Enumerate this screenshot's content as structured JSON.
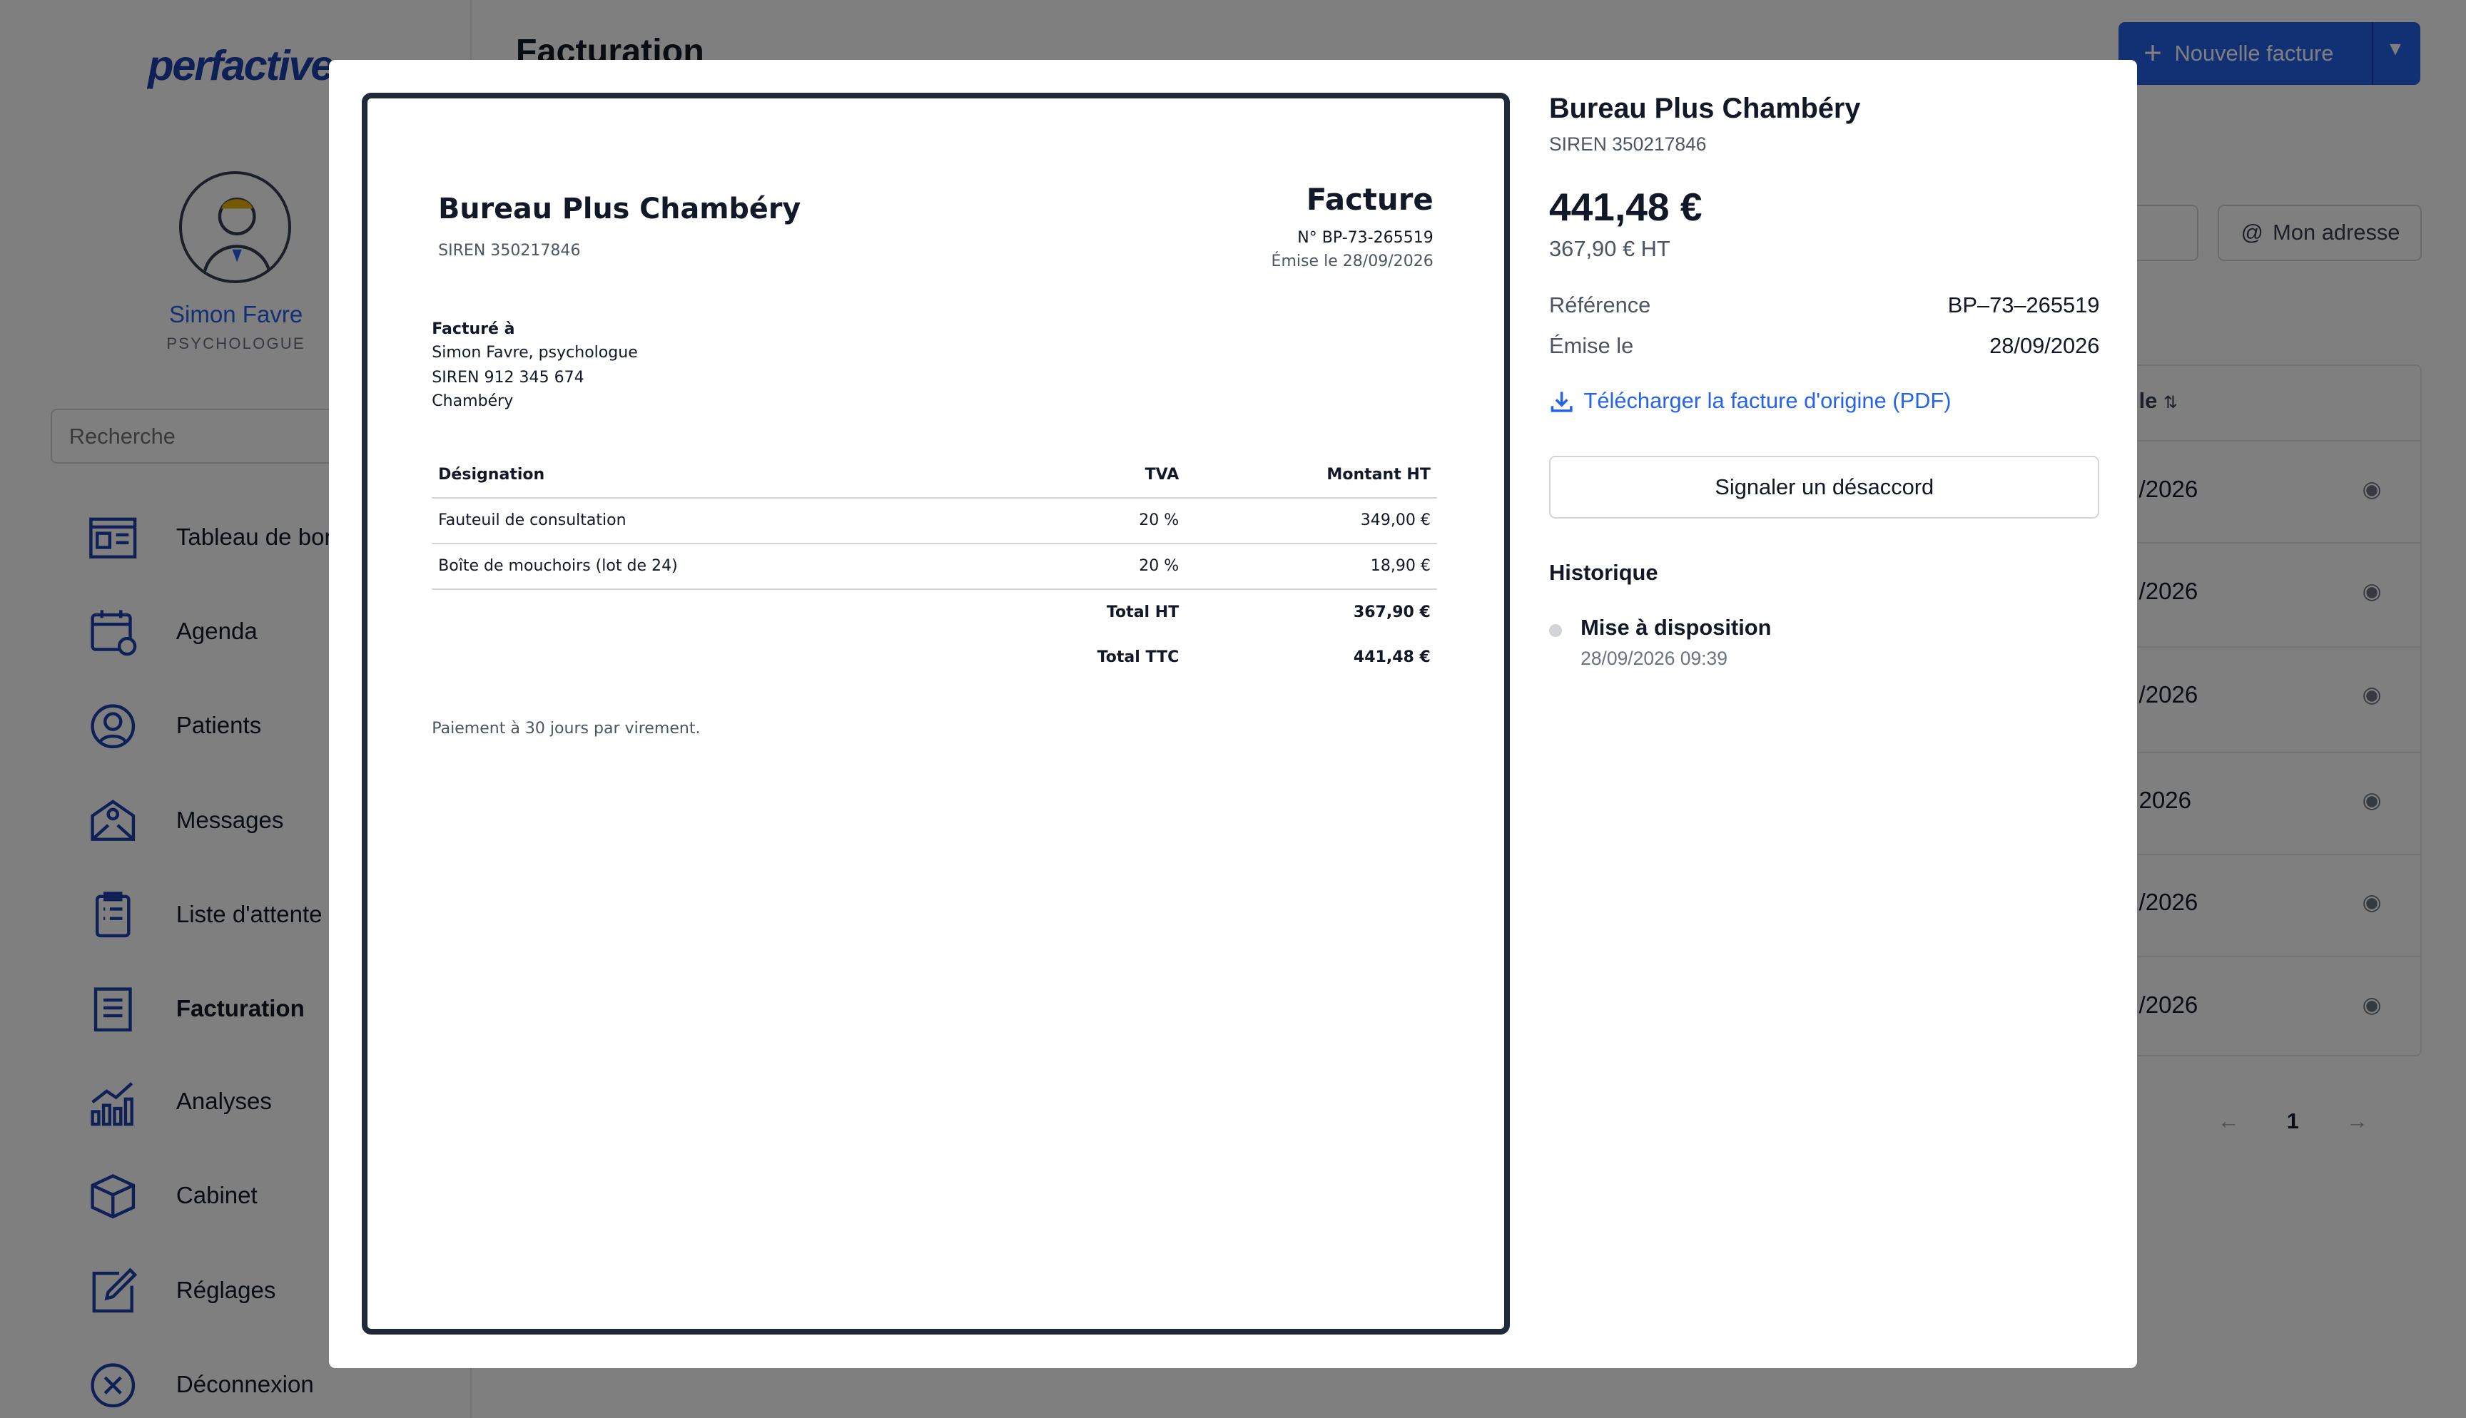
{
  "app": {
    "logo": "perfactive",
    "page_title": "Facturation"
  },
  "user": {
    "name": "Simon Favre",
    "role": "PSYCHOLOGUE"
  },
  "search": {
    "placeholder": "Recherche"
  },
  "nav": [
    {
      "label": "Tableau de bord",
      "icon": "dashboard-icon"
    },
    {
      "label": "Agenda",
      "icon": "calendar-icon"
    },
    {
      "label": "Patients",
      "icon": "user-circle-icon"
    },
    {
      "label": "Messages",
      "icon": "mail-at-icon"
    },
    {
      "label": "Liste d'attente",
      "icon": "clipboard-list-icon"
    },
    {
      "label": "Facturation",
      "icon": "invoice-icon",
      "active": true
    },
    {
      "label": "Analyses",
      "icon": "chart-growth-icon"
    },
    {
      "label": "Cabinet",
      "icon": "box-icon"
    },
    {
      "label": "Réglages",
      "icon": "edit-icon"
    },
    {
      "label": "Déconnexion",
      "icon": "close-circle-icon"
    }
  ],
  "toolbar": {
    "new_invoice": "Nouvelle facture",
    "address": "Mon adresse"
  },
  "table": {
    "header": "le",
    "rows": [
      "/2026",
      "/2026",
      "/2026",
      "2026",
      "/2026",
      "/2026"
    ]
  },
  "pagination": {
    "current": "1",
    "prev": "←",
    "next": "→"
  },
  "invoice_doc": {
    "company": "Bureau Plus Chambéry",
    "siren": "SIREN 350217846",
    "title": "Facture",
    "number": "N° BP-73-265519",
    "issued": "Émise le 28/09/2026",
    "billed_to_label": "Facturé à",
    "billed_to": [
      "Simon Favre, psychologue",
      "SIREN 912 345 674",
      "Chambéry"
    ],
    "columns": {
      "designation": "Désignation",
      "tva": "TVA",
      "amount": "Montant HT"
    },
    "items": [
      {
        "designation": "Fauteuil de consultation",
        "tva": "20 %",
        "amount": "349,00 €"
      },
      {
        "designation": "Boîte de mouchoirs (lot de 24)",
        "tva": "20 %",
        "amount": "18,90 €"
      }
    ],
    "total_ht_label": "Total HT",
    "total_ht": "367,90 €",
    "total_ttc_label": "Total TTC",
    "total_ttc": "441,48 €",
    "payment_note": "Paiement à 30 jours par virement."
  },
  "invoice_info": {
    "company": "Bureau Plus Chambéry",
    "siren": "SIREN 350217846",
    "amount_ttc": "441,48 €",
    "amount_ht": "367,90 € HT",
    "reference_label": "Référence",
    "reference": "BP–73–265519",
    "issued_label": "Émise le",
    "issued": "28/09/2026",
    "download": "Télécharger la facture d'origine (PDF)",
    "dispute": "Signaler un désaccord",
    "history_title": "Historique",
    "history": [
      {
        "event": "Mise à disposition",
        "time": "28/09/2026 09:39"
      }
    ]
  },
  "colors": {
    "accent": "#2563eb",
    "brand": "#1e40af",
    "overlay": "rgba(0,0,0,0.5)"
  }
}
